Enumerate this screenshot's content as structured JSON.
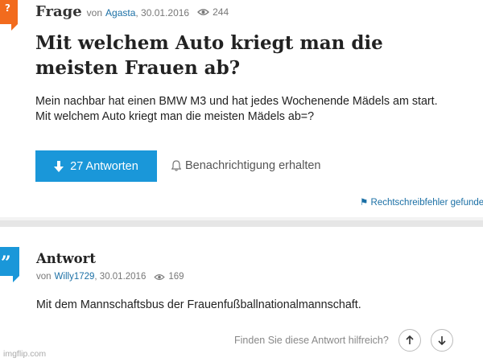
{
  "question": {
    "label": "Frage",
    "by_prefix": "von",
    "author": "Agasta",
    "date": ", 30.01.2016",
    "views": "244",
    "title": "Mit welchem Auto kriegt man die meisten Frauen ab?",
    "body_line1": "Mein nachbar hat einen BMW M3 und hat jedes Wochenende Mädels am start.",
    "body_line2": "Mit welchem Auto kriegt man die meisten Mädels ab=?",
    "answers_button": "27 Antworten",
    "notify_label": "Benachrichtigung erhalten",
    "report_label": "Rechtschreibfehler gefunde"
  },
  "answer": {
    "label": "Antwort",
    "by_prefix": "von",
    "author": "Willy1729",
    "date": ", 30.01.2016",
    "views": "169",
    "body": "Mit dem Mannschaftsbus der Frauenfußballnationalmannschaft.",
    "helpful_prompt": "Finden Sie diese Antwort hilfreich?"
  },
  "watermark": "imgflip.com",
  "colors": {
    "accent_orange": "#f26b1d",
    "answer_badge_blue": "#1a97d9",
    "primary_button": "#1a97d9",
    "link": "#1a6fa5"
  },
  "icons": {
    "question_badge": "question-mark-badge-icon",
    "answer_badge": "quote-badge-icon",
    "views": "eye-icon",
    "answers_button": "arrow-down-icon",
    "notify": "bell-icon",
    "report": "flag-icon",
    "vote_up": "arrow-up-icon",
    "vote_down": "arrow-down-icon"
  }
}
